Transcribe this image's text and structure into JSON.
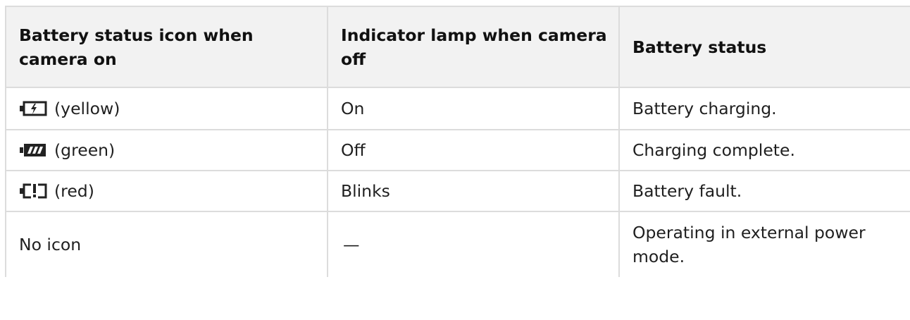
{
  "table": {
    "headers": [
      "Battery status icon when camera on",
      "Indicator lamp when camera off",
      "Battery status"
    ],
    "rows": [
      {
        "icon": "battery-charging-icon",
        "icon_label": "(yellow)",
        "lamp": "On",
        "status": "Battery charging."
      },
      {
        "icon": "battery-full-icon",
        "icon_label": "(green)",
        "lamp": "Off",
        "status": "Charging complete."
      },
      {
        "icon": "battery-fault-icon",
        "icon_label": "(red)",
        "lamp": "Blinks",
        "status": "Battery fault."
      },
      {
        "icon": "",
        "icon_label": "No icon",
        "lamp": "—",
        "status": "Operating in external power mode."
      }
    ]
  }
}
